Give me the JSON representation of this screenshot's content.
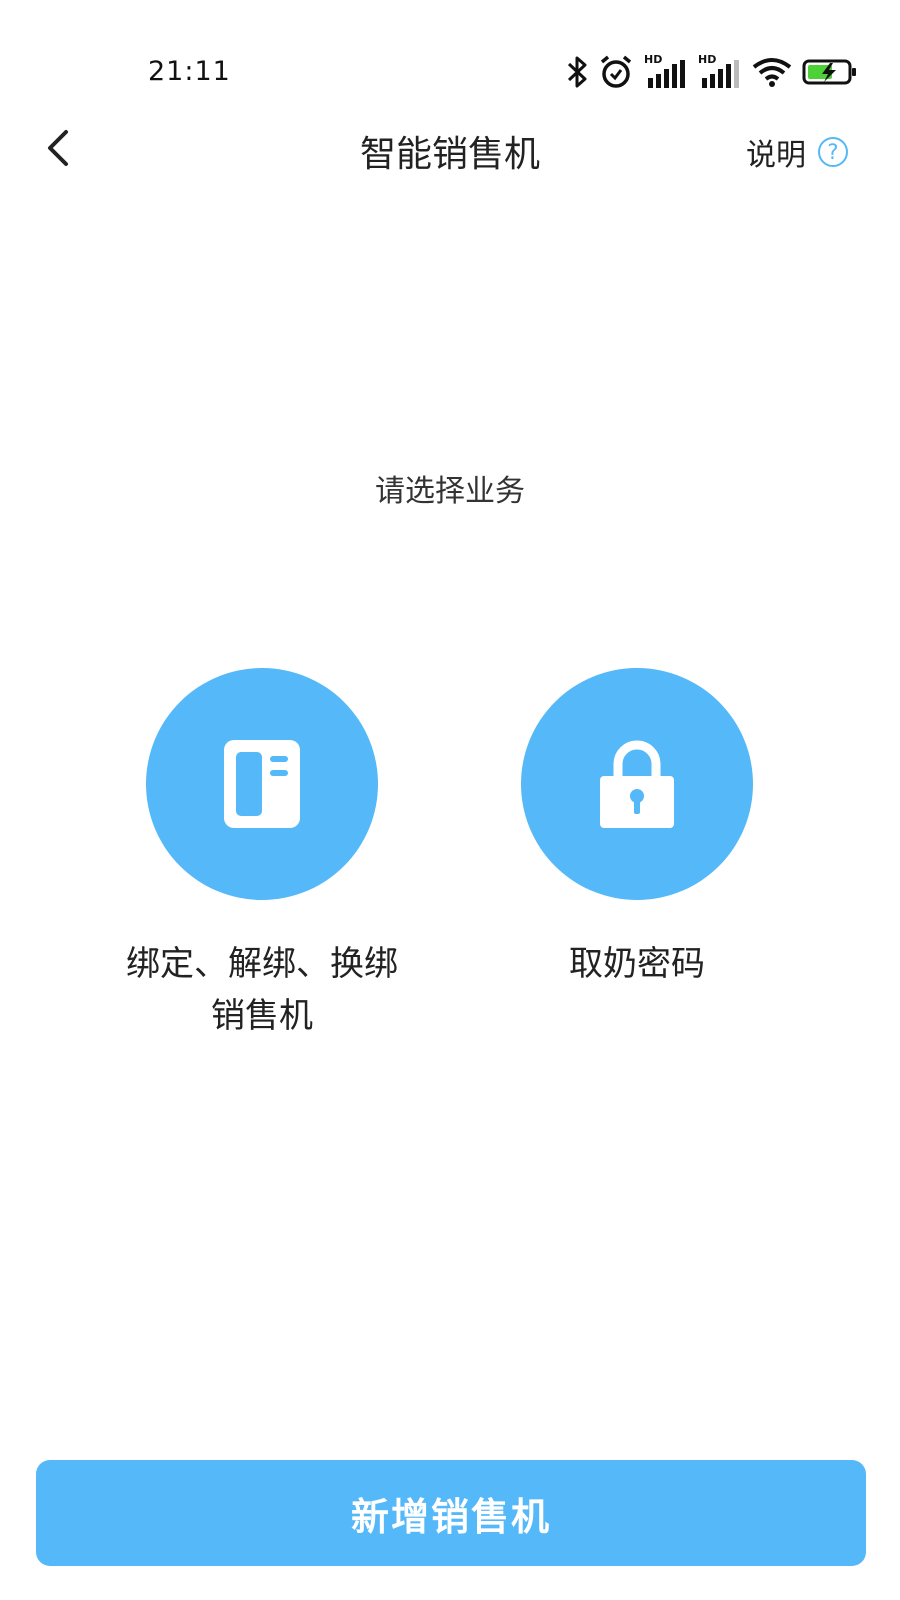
{
  "status_bar": {
    "time": "21:11",
    "sim1_label": "HD",
    "sim2_label": "HD",
    "icons": [
      "bluetooth-icon",
      "alarm-icon",
      "signal-icon",
      "signal-icon",
      "wifi-icon",
      "battery-charging-icon"
    ]
  },
  "nav": {
    "title": "智能销售机",
    "help_label": "说明",
    "help_icon_glyph": "?"
  },
  "content": {
    "prompt": "请选择业务",
    "options": [
      {
        "label": "绑定、解绑、换绑\n销售机",
        "icon": "vending-machine-icon"
      },
      {
        "label": "取奶密码",
        "icon": "lock-icon"
      }
    ]
  },
  "footer": {
    "add_button_label": "新增销售机"
  },
  "colors": {
    "accent": "#55b8f8",
    "text": "#222222",
    "background": "#ffffff",
    "battery_green": "#4cd137"
  }
}
